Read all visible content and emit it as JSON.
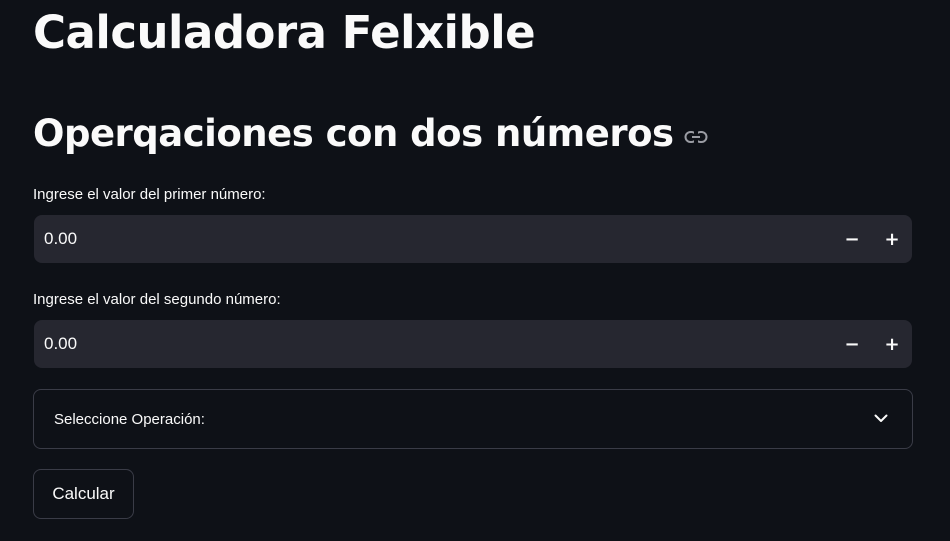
{
  "app": {
    "title": "Calculadora Felxible"
  },
  "section": {
    "title": "Operqaciones con dos números",
    "anchor_icon": "link-icon"
  },
  "inputs": [
    {
      "label": "Ingrese el valor del primer número:",
      "value": "0.00",
      "decrement_label": "−",
      "increment_label": "+"
    },
    {
      "label": "Ingrese el valor del segundo número:",
      "value": "0.00",
      "decrement_label": "−",
      "increment_label": "+"
    }
  ],
  "operation_select": {
    "label": "Seleccione Operación:",
    "icon": "chevron-down-icon"
  },
  "actions": {
    "calculate_label": "Calcular"
  },
  "colors": {
    "background": "#0e1117",
    "input_background": "#262730",
    "border": "#3a3c47",
    "text": "#fafafa",
    "icon_muted": "#9a9ca3"
  }
}
